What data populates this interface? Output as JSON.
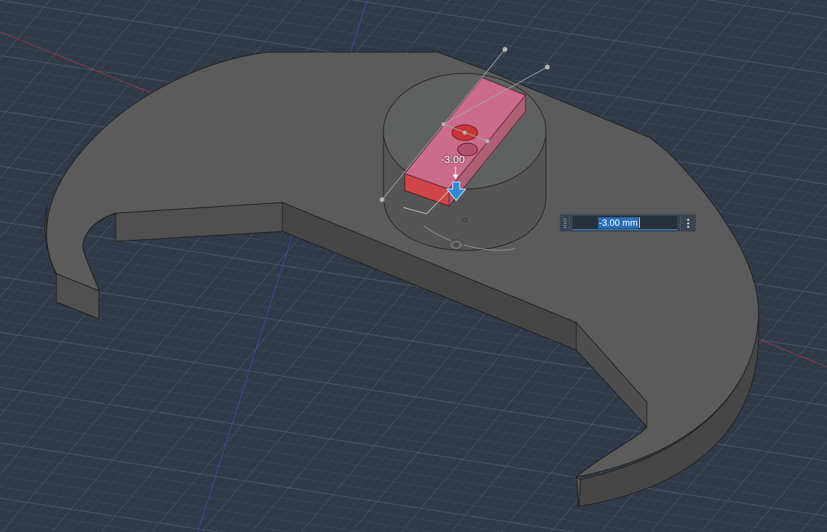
{
  "viewport": {
    "background": "#2f3947",
    "grid_color": "#4a5868",
    "axis_x_color": "#8a3a44",
    "axis_y_color": "#3a4a9a"
  },
  "model": {
    "body_color": "#5a5a5a",
    "side_color": "#4a4a4a",
    "boss_top_color": "#5e6160",
    "cut_preview_color": "#c4607a",
    "cut_face_color": "#d04545"
  },
  "extrude": {
    "dimension_label": "-3.00",
    "direction_icon": "arrow-down-icon"
  },
  "dimension_input": {
    "value": "-3.00 mm",
    "accent": "#3d9ee0"
  }
}
